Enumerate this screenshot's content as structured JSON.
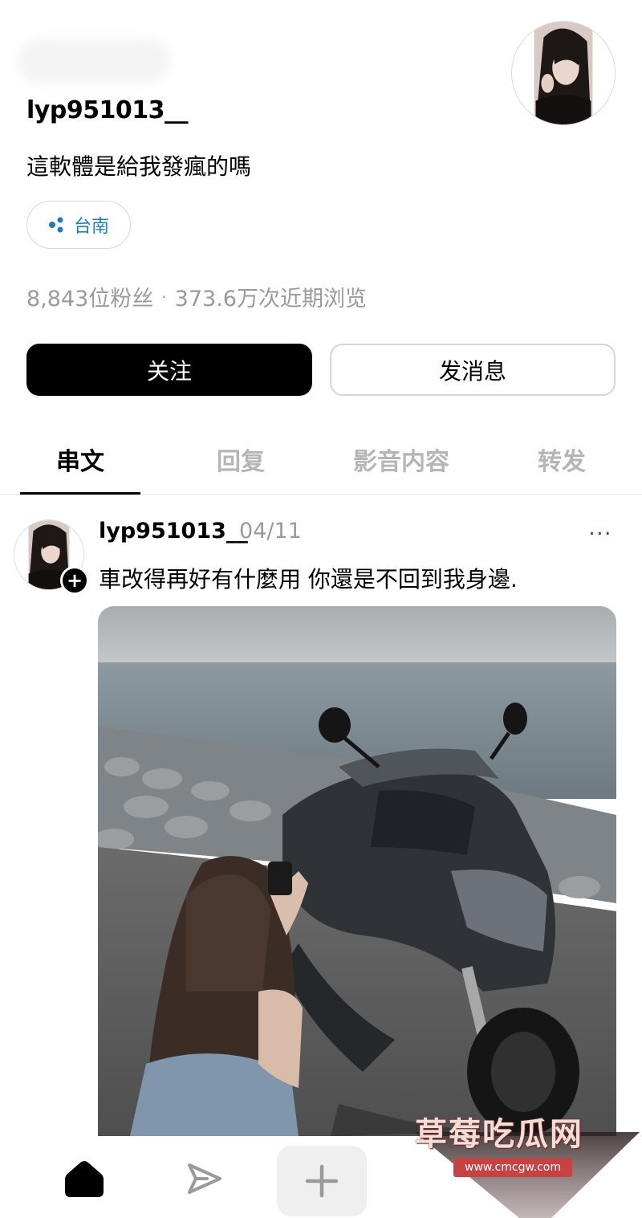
{
  "profile": {
    "username": "lyp951013__",
    "bio": "這軟體是給我發瘋的嗎",
    "location": "台南",
    "followers": "8,843位粉丝",
    "separator": "·",
    "views": "373.6万次近期浏览"
  },
  "actions": {
    "follow_label": "关注",
    "message_label": "发消息"
  },
  "tabs": [
    {
      "label": "串文",
      "active": true
    },
    {
      "label": "回复",
      "active": false
    },
    {
      "label": "影音内容",
      "active": false
    },
    {
      "label": "转发",
      "active": false
    }
  ],
  "post": {
    "username": "lyp951013__",
    "date": "04/11",
    "more": "···",
    "text": "車改得再好有什麼用 你還是不回到我身邊.",
    "plus": "+"
  },
  "nav": {
    "icons": [
      "home-icon",
      "send-icon",
      "add-icon"
    ]
  },
  "watermark": {
    "title": "草莓吃瓜网",
    "url": "www.cmcgw.com"
  },
  "colors": {
    "accent_location": "#1f7fb5",
    "follow_bg": "#000000",
    "muted_text": "#9a9a9a"
  }
}
